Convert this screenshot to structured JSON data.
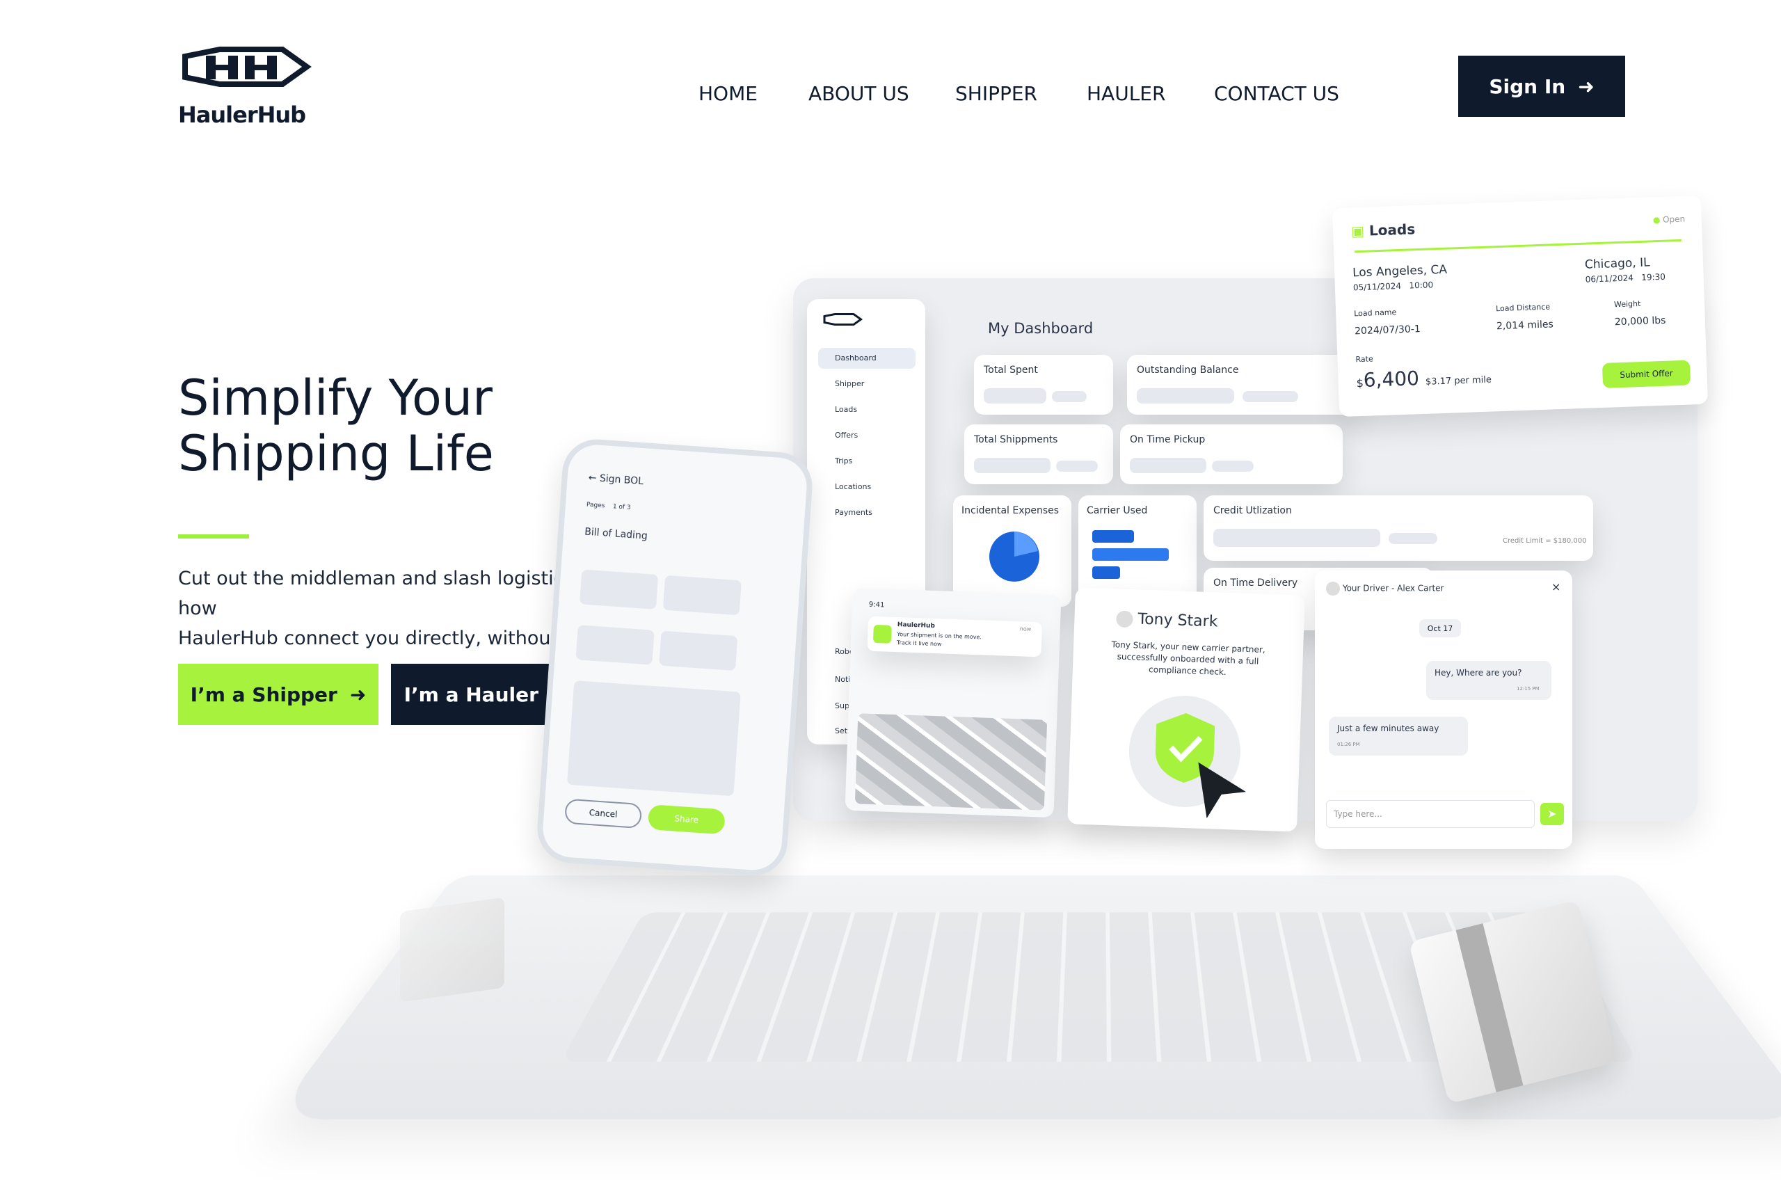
{
  "brand": {
    "name": "HaulerHub"
  },
  "nav": {
    "items": [
      "HOME",
      "ABOUT US",
      "SHIPPER",
      "HAULER",
      "CONTACT US"
    ],
    "sign_in": "Sign In"
  },
  "hero": {
    "title_line1": "Simplify Your",
    "title_line2": "Shipping Life",
    "subtitle_line1": "Cut out the middleman and slash logistics costs. See how",
    "subtitle_line2": "HaulerHub connect you directly, without the fuss.",
    "cta_shipper": "I’m a Shipper",
    "cta_hauler": "I’m a Hauler"
  },
  "colors": {
    "navy": "#0f1b2d",
    "lime": "#a6f23c",
    "bg": "#ffffff"
  },
  "illustration": {
    "dashboard": {
      "title": "My Dashboard",
      "sidebar": [
        "Dashboard",
        "Shipper",
        "Loads",
        "Offers",
        "Trips",
        "Locations",
        "Payments"
      ],
      "sidebar_bottom": [
        "Robert Adams",
        "Notifications",
        "Support",
        "Settings"
      ],
      "tiles": [
        "Total Spent",
        "Outstanding Balance",
        "Total Shippments",
        "On Time Pickup",
        "Incidental Expenses",
        "Carrier Used",
        "Credit Utlization",
        "On Time Delivery"
      ],
      "credit_limit": "Credit Limit = $180,000"
    },
    "loads": {
      "title": "Loads",
      "status": "Open",
      "origin": "Los Angeles, CA",
      "origin_date": "05/11/2024",
      "origin_time": "10:00",
      "destination": "Chicago, IL",
      "destination_date": "06/11/2024",
      "destination_time": "19:30",
      "load_name_label": "Load name",
      "load_name": "2024/07/30-1",
      "distance_label": "Load Distance",
      "distance": "2,014 miles",
      "weight_label": "Weight",
      "weight": "20,000 lbs",
      "rate_label": "Rate",
      "rate_currency": "$",
      "rate": "6,400",
      "rate_per_mile": "$3.17 per mile",
      "submit": "Submit Offer"
    },
    "phone": {
      "header": "Sign BOL",
      "pages_label": "Pages",
      "pages": "1 of 3",
      "doc_title": "Bill of Lading",
      "cancel": "Cancel",
      "share": "Share"
    },
    "mini_phone": {
      "time": "9:41",
      "notif_title": "HaulerHub",
      "notif_body": "Your shipment is on the move.",
      "notif_link": "Track it live now",
      "notif_time": "now"
    },
    "carrier_card": {
      "name": "Tony Stark",
      "text": "Tony Stark, your new carrier partner, successfully onboarded with a full compliance check."
    },
    "chat": {
      "header": "Your Driver - Alex Carter",
      "date": "Oct 17",
      "msg1": "Hey, Where are you?",
      "msg1_time": "12:15 PM",
      "msg2": "Just a few minutes away",
      "msg2_time": "01:26 PM",
      "placeholder": "Type here..."
    }
  }
}
